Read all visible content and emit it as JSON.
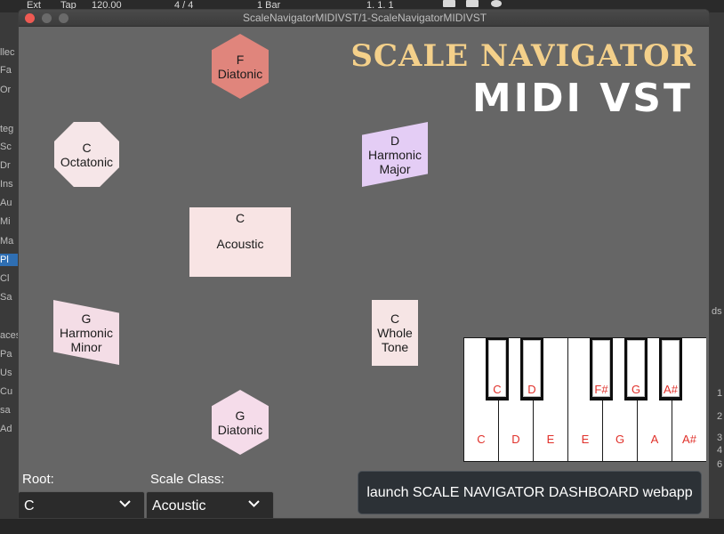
{
  "host": {
    "top_items": [
      "Ext",
      "Tap",
      "120.00",
      "4 / 4",
      "1 Bar",
      "1.   1.   1"
    ],
    "left_items": [
      "llec",
      "Fa",
      "Or",
      "teg",
      "Sc",
      "Dr",
      "Ins",
      "Au",
      "Mi",
      "Ma",
      "Pl",
      "Cl",
      "Sa",
      "aces",
      "Pa",
      "Us",
      "Cu",
      "sa",
      "Ad"
    ],
    "right_items": [
      "ds",
      "1",
      "2",
      "3",
      "4",
      "6"
    ]
  },
  "window": {
    "title": "ScaleNavigatorMIDIVST/1-ScaleNavigatorMIDIVST"
  },
  "brand": {
    "line1": "SCALE NAVIGATOR",
    "line2": "MIDI VST"
  },
  "nodes": {
    "f_diatonic": {
      "root": "F",
      "name": "Diatonic"
    },
    "c_octatonic": {
      "root": "C",
      "name": "Octatonic"
    },
    "d_harmonic_major": {
      "root": "D",
      "line1": "Harmonic",
      "line2": "Major"
    },
    "c_acoustic": {
      "root": "C",
      "name": "Acoustic"
    },
    "g_harmonic_minor": {
      "root": "G",
      "line1": "Harmonic",
      "line2": "Minor"
    },
    "c_whole_tone": {
      "root": "C",
      "line1": "Whole",
      "line2": "Tone"
    },
    "g_diatonic": {
      "root": "G",
      "name": "Diatonic"
    }
  },
  "keyboard": {
    "white_keys": [
      "C",
      "D",
      "E",
      "E",
      "G",
      "A",
      "A#"
    ],
    "black_keys": [
      "C",
      "D",
      "F#",
      "G",
      "A#"
    ]
  },
  "controls": {
    "root_label": "Root:",
    "root_value": "C",
    "scale_class_label": "Scale Class:",
    "scale_class_value": "Acoustic",
    "launch_label": "launch SCALE NAVIGATOR DASHBOARD webapp"
  },
  "colors": {
    "accent_brand": "#f4d08a",
    "key_label": "#e0302a",
    "close_button": "#ee5a53"
  }
}
